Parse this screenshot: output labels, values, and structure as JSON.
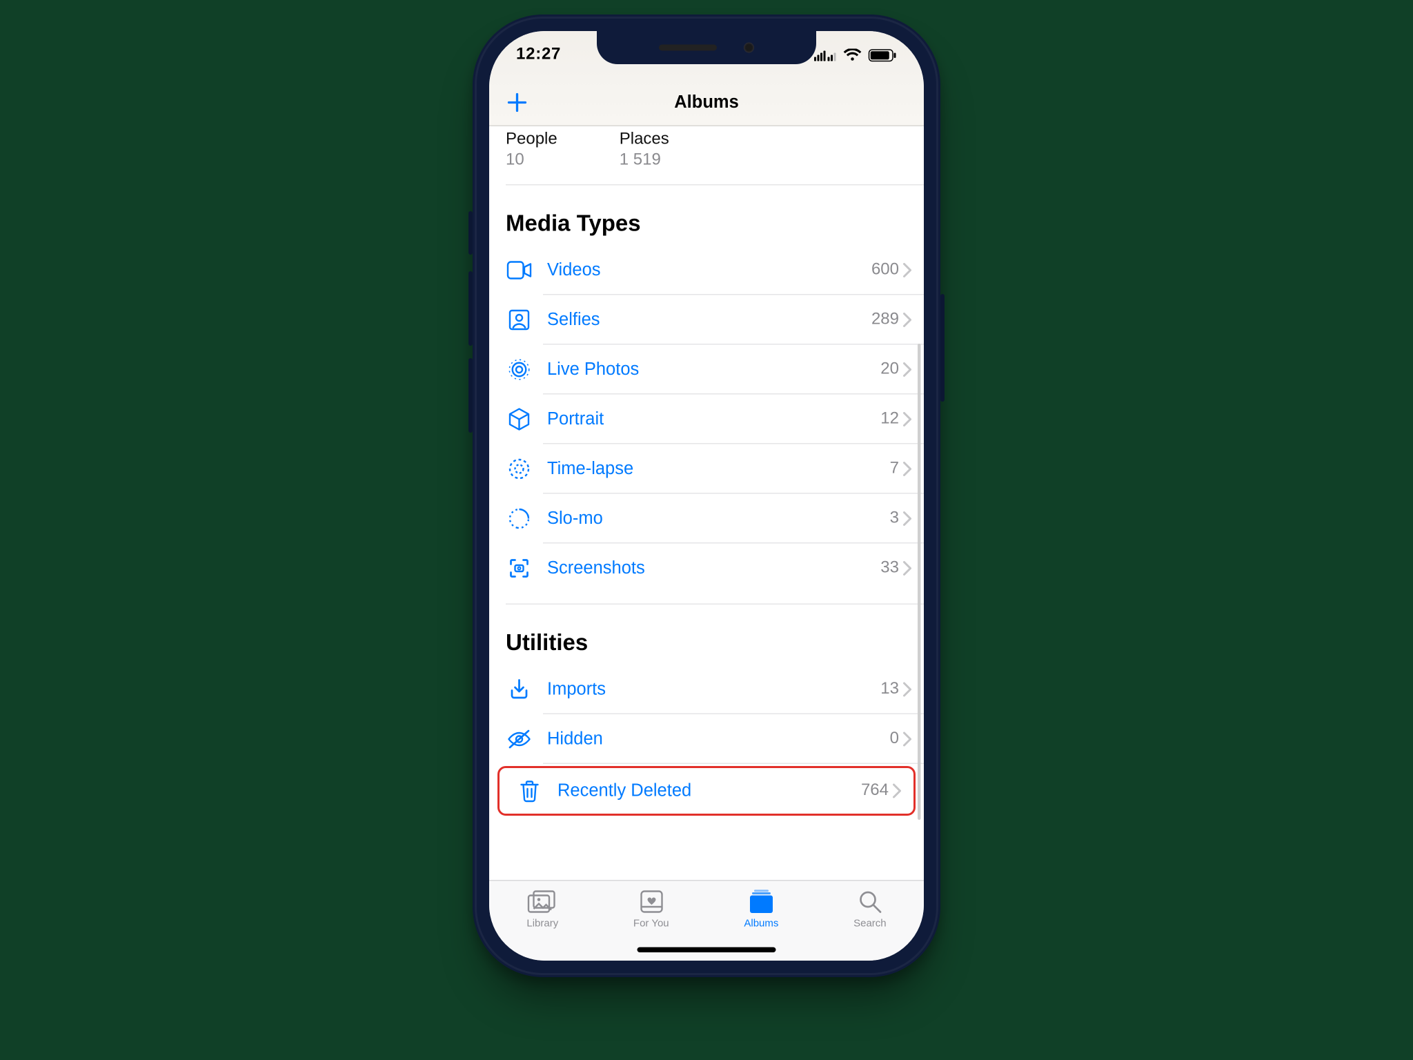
{
  "status": {
    "time": "12:27"
  },
  "nav": {
    "title": "Albums",
    "add_icon": "plus-icon"
  },
  "summary": {
    "people": {
      "label": "People",
      "count": "10"
    },
    "places": {
      "label": "Places",
      "count": "1 519"
    }
  },
  "sections": {
    "media_types": {
      "title": "Media Types",
      "items": [
        {
          "icon": "video-icon",
          "label": "Videos",
          "count": "600"
        },
        {
          "icon": "selfie-icon",
          "label": "Selfies",
          "count": "289"
        },
        {
          "icon": "live-photo-icon",
          "label": "Live Photos",
          "count": "20"
        },
        {
          "icon": "portrait-icon",
          "label": "Portrait",
          "count": "12"
        },
        {
          "icon": "timelapse-icon",
          "label": "Time-lapse",
          "count": "7"
        },
        {
          "icon": "slomo-icon",
          "label": "Slo-mo",
          "count": "3"
        },
        {
          "icon": "screenshot-icon",
          "label": "Screenshots",
          "count": "33"
        }
      ]
    },
    "utilities": {
      "title": "Utilities",
      "items": [
        {
          "icon": "import-icon",
          "label": "Imports",
          "count": "13"
        },
        {
          "icon": "hidden-icon",
          "label": "Hidden",
          "count": "0"
        },
        {
          "icon": "trash-icon",
          "label": "Recently Deleted",
          "count": "764",
          "highlight": true
        }
      ]
    }
  },
  "tabs": [
    {
      "id": "library",
      "label": "Library"
    },
    {
      "id": "foryou",
      "label": "For You"
    },
    {
      "id": "albums",
      "label": "Albums",
      "active": true
    },
    {
      "id": "search",
      "label": "Search"
    }
  ],
  "colors": {
    "accent": "#007aff",
    "highlight_border": "#e2302a"
  }
}
